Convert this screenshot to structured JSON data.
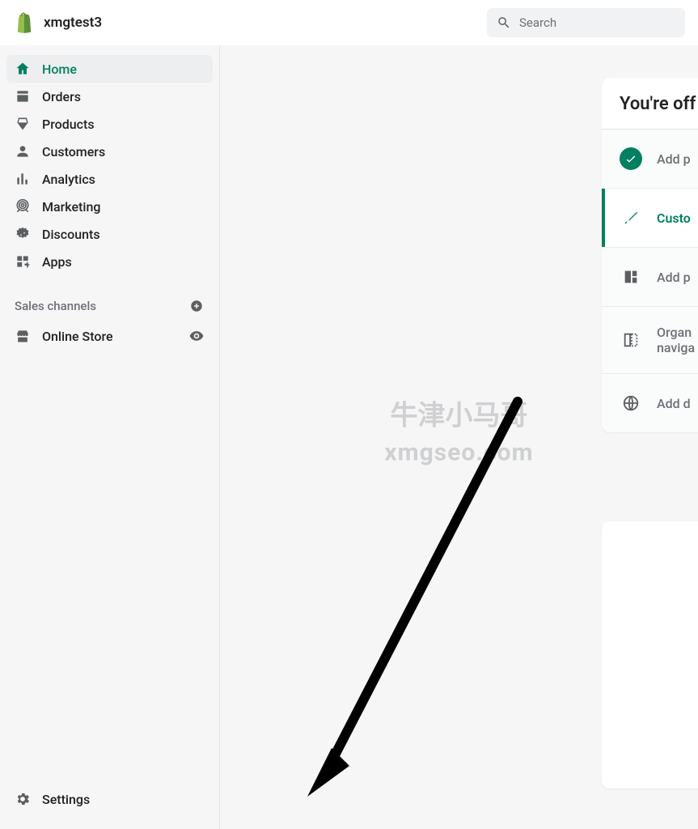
{
  "topbar": {
    "store_name": "xmgtest3",
    "search_placeholder": "Search"
  },
  "sidebar": {
    "items": [
      {
        "label": "Home",
        "icon": "home-icon",
        "active": true
      },
      {
        "label": "Orders",
        "icon": "orders-icon",
        "active": false
      },
      {
        "label": "Products",
        "icon": "products-icon",
        "active": false
      },
      {
        "label": "Customers",
        "icon": "customers-icon",
        "active": false
      },
      {
        "label": "Analytics",
        "icon": "analytics-icon",
        "active": false
      },
      {
        "label": "Marketing",
        "icon": "marketing-icon",
        "active": false
      },
      {
        "label": "Discounts",
        "icon": "discounts-icon",
        "active": false
      },
      {
        "label": "Apps",
        "icon": "apps-icon",
        "active": false
      }
    ],
    "sales_channels_header": "Sales channels",
    "channels": [
      {
        "label": "Online Store",
        "icon": "store-icon"
      }
    ],
    "settings_label": "Settings"
  },
  "main": {
    "setup": {
      "title": "You're off",
      "rows": [
        {
          "label": "Add p",
          "state": "done",
          "icon": "check-icon"
        },
        {
          "label": "Custo",
          "state": "active",
          "icon": "brush-icon"
        },
        {
          "label": "Add p",
          "state": "todo",
          "icon": "pages-icon"
        },
        {
          "label": "Organ\nnaviga",
          "state": "todo",
          "icon": "organize-icon"
        },
        {
          "label": "Add d",
          "state": "todo",
          "icon": "globe-icon"
        }
      ]
    }
  },
  "watermark": {
    "line1": "牛津小马哥",
    "line2": "xmgseo.com"
  },
  "colors": {
    "accent": "#008060",
    "bg": "#f6f6f7"
  }
}
